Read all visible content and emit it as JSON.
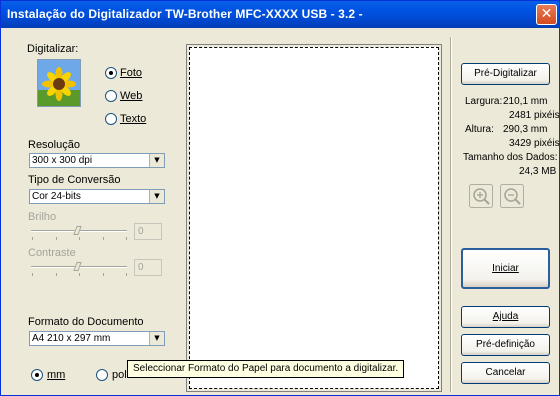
{
  "window": {
    "title": "Instalação do Digitalizador TW-Brother MFC-XXXX     USB - 3.2 -",
    "close_symbol": "✕"
  },
  "scan_type": {
    "label": "Digitalizar:",
    "options": [
      {
        "label": "Foto",
        "selected": true
      },
      {
        "label": "Web",
        "selected": false
      },
      {
        "label": "Texto",
        "selected": false
      }
    ],
    "thumbnail_icon": "sunflower-photo-icon"
  },
  "resolution": {
    "label": "Resolução",
    "value": "300 x 300 dpi"
  },
  "conversion": {
    "label": "Tipo de Conversão",
    "value": "Cor 24-bits"
  },
  "brightness": {
    "label": "Brilho",
    "value": "0",
    "level": 0.5
  },
  "contrast": {
    "label": "Contraste",
    "value": "0",
    "level": 0.5
  },
  "document_size": {
    "label": "Formato do Documento",
    "value": "A4 210 x 297 mm"
  },
  "units": {
    "options": [
      {
        "label": "mm",
        "selected": true
      },
      {
        "label": "pol",
        "selected": false
      }
    ]
  },
  "tooltip": {
    "text": "Seleccionar Formato do Papel para documento a digitalizar."
  },
  "buttons": {
    "prescan": "Pré-Digitalizar",
    "start": "Iniciar",
    "help": "Ajuda",
    "default": "Pré-definição",
    "cancel": "Cancelar"
  },
  "info": {
    "width_label": "Largura:",
    "width_mm": "210,1 mm",
    "width_px": "2481 pixéis",
    "height_label": "Altura:",
    "height_mm": "290,3 mm",
    "height_px": "3429 pixéis",
    "data_size_label": "Tamanho dos Dados:",
    "data_size_value": "24,3 MB"
  },
  "zoom": {
    "zoom_in_icon": "zoom-in-icon",
    "zoom_out_icon": "zoom-out-icon"
  }
}
